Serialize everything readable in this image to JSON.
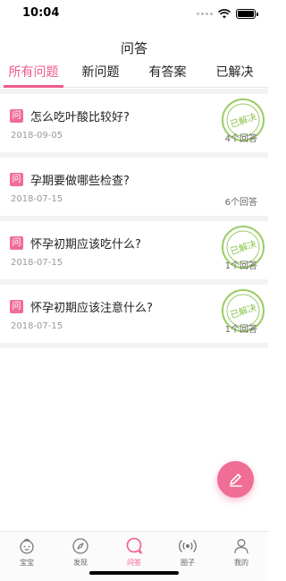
{
  "status_bar": {
    "time": "10:04",
    "icons": [
      "signal-dots-icon",
      "wifi-icon",
      "battery-icon"
    ]
  },
  "nav": {
    "title": "问答"
  },
  "tabs": [
    {
      "label": "所有问题",
      "active": true
    },
    {
      "label": "新问题",
      "active": false
    },
    {
      "label": "有答案",
      "active": false
    },
    {
      "label": "已解决",
      "active": false
    }
  ],
  "question_icon_text": "问",
  "questions": [
    {
      "title": "怎么吃叶酸比较好?",
      "date": "2018-09-05",
      "count": "4个回答",
      "resolved": true,
      "stamp_text": "已解决"
    },
    {
      "title": "孕期要做哪些检查?",
      "date": "2018-07-15",
      "count": "6个回答",
      "resolved": false,
      "stamp_text": ""
    },
    {
      "title": "怀孕初期应该吃什么?",
      "date": "2018-07-15",
      "count": "1个回答",
      "resolved": true,
      "stamp_text": "已解决"
    },
    {
      "title": "怀孕初期应该注意什么?",
      "date": "2018-07-15",
      "count": "1个回答",
      "resolved": true,
      "stamp_text": "已解决"
    }
  ],
  "fab": {
    "icon": "edit-icon"
  },
  "tab_bar": [
    {
      "label": "宝宝",
      "icon": "baby-icon",
      "active": false
    },
    {
      "label": "发现",
      "icon": "compass-icon",
      "active": false
    },
    {
      "label": "问答",
      "icon": "chat-bubble-icon",
      "active": true
    },
    {
      "label": "圈子",
      "icon": "broadcast-icon",
      "active": false
    },
    {
      "label": "我的",
      "icon": "user-icon",
      "active": false
    }
  ],
  "colors": {
    "accent": "#f05a8a",
    "stamp": "#8bc34a"
  }
}
